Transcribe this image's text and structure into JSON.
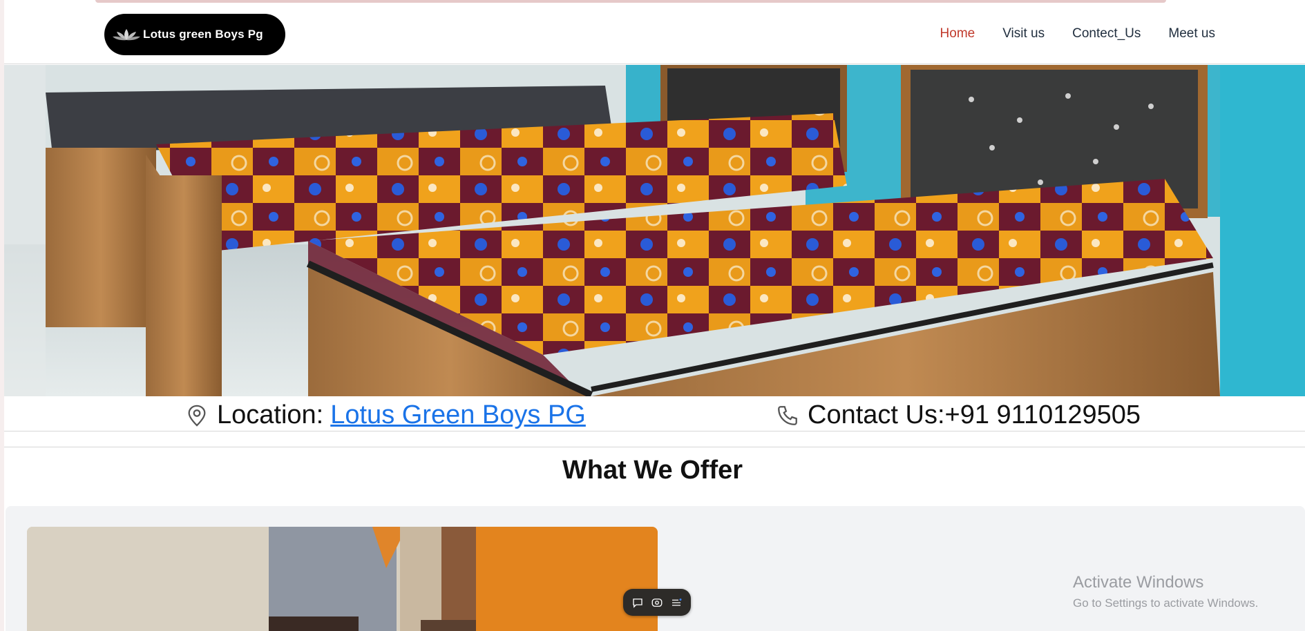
{
  "brand": {
    "name": "Lotus green Boys Pg"
  },
  "nav": {
    "items": [
      {
        "label": "Home",
        "active": true
      },
      {
        "label": "Visit us",
        "active": false
      },
      {
        "label": "Contect_Us",
        "active": false
      },
      {
        "label": "Meet us",
        "active": false
      }
    ]
  },
  "colors": {
    "nav_active": "#c0392b",
    "nav_text": "#1f2d3d",
    "link": "#1a73e8"
  },
  "info": {
    "location_label": "Location:",
    "location_link": "Lotus Green Boys PG",
    "contact_text": "Contact Us:+91 9110129505"
  },
  "section": {
    "title": "What We Offer"
  },
  "icons": [
    "lotus-logo-icon",
    "location-pin-icon",
    "phone-icon",
    "chat-icon",
    "record-icon",
    "menu-icon"
  ],
  "os_overlay": {
    "title": "Activate Windows",
    "subtitle": "Go to Settings to activate Windows."
  }
}
